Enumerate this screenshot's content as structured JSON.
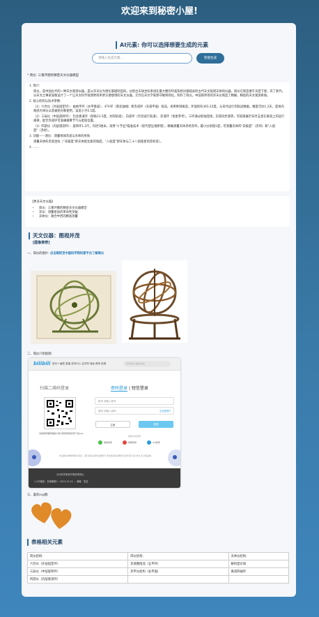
{
  "site_title": "欢迎来到秘密小屋!",
  "ai": {
    "heading": "AI元素: 你可以选择想要生成的元素",
    "placeholder": "请输入生成元素...",
    "button": "智能生成"
  },
  "summary_label": "* 简仪: 三重环圈的精密天文仪器模型",
  "article": {
    "p1": "1. 简介:",
    "p2": "简仪，是中国古代的一种天文观测仪器，是以浑天仪为理论基础制造的。分把古天球坐标系组在最大圈的环面及相对基础会的古代天文观测天体的仪器。简仪在制造便于天度下使，有了新代，分天文之事家张衡设计了一个让天文科学观测更简单更方便使用的天文仪器。元代在天文学家郭守敬将简化，制作了简仪。中国简单等的浑天仪制造了精确，精密的天文观测系统。",
    "p3": "2. 核心结构与技术参数:",
    "p4": "（1）六合仪（外层固定环）：由地平环（水平基座）、子午环（南北轴线）和赤道环（天道平面）组成。采用青铜铸造，环面刻有365.25度，与日月运行的轨迹数据，精度可达1.2天，是地内两部大体仪以及被组对象使用，误差小于0.1度。",
    "p5": "（2）三辰仪（中层旋转环）：包含黄道环（倾角23.5度，太阳轨道）、白道环（月亮运行轨道）、赤道环（恒星参考）。三环通过枢轴连接，实现同步旋转，可直观展示日月五星在黄道上的运行规律，配合赤道环可准确推算节气与星宿位置。",
    "p6": "（3）四游仪（内层观测环）：旋转环1.2尺，内径5厘米，采用\"十字丝\"瞄准技术（现代望远镜原理），精确测量天体赤经赤纬，最小分划值1度，可测量天体的\"去极度\"（赤纬）和\"入宿度\"（赤经）。",
    "p7": "3. 功能——测仪：测量地球赤道与天体的夹角",
    "p8": "测量天体的赤道坐标（\"去极度\"即天体距北极的角度，\"入宿度\"即天体与二十八宿距星的赤经差）。",
    "p9": "4. ……"
  },
  "refs": {
    "title": "【更多天文仪器】",
    "items": [
      "简仪：三重环圈的精密天文仪器模型",
      "浑仪：测量星辰的革命性突破",
      "天体仪：融合中西的精准测量"
    ]
  },
  "astro": {
    "heading": "天文仪器：图视并茂",
    "sub": "[图像推荐]",
    "l1_prefix": "一、简仪的图片:",
    "l1_link": "点击跳转至中国科学院科普平台了解简仪",
    "l2": "二、简仪介绍视频:",
    "l3": "三、喜欢svg图:"
  },
  "browser": {
    "logo": "bilibili",
    "nav": "首页 ▾  番剧  直播  游戏中心  会员购  漫画  赛事  投稿",
    "search": "搜索你感兴趣的视频",
    "tab_scan": "扫描二维码登录",
    "tab_pwd": "密码登录",
    "tab_sms": "短信登录",
    "qr_text": "请使用哔哩哔哩客户端 扫码登录或扫码下载App",
    "field_account": "账号  请输入账号",
    "field_pwd": "密码  请输入密码",
    "forgot": "忘记密码?",
    "btn_register": "注册",
    "btn_login": "登录",
    "other_login": "其他方式登录",
    "icon_wechat": "微信登录",
    "icon_weibo": "微博登录",
    "icon_qq": "QQ登录",
    "agreement": "未注册过哔哩哔哩的手机号，我们将自动帮你注册账号 登录或完成注册即代表你同意 用户协议 和 隐私政策",
    "overlay_text": "元代科学家郭守敬发明简仪",
    "overlay_bottom": "1,4万播放 · 总弹幕数0 · 2023-10-22 ...     弹幕 · 发送",
    "colors": {
      "accent": "#2a9ad8",
      "login": "#6cc8f0"
    }
  },
  "table": {
    "heading": "表格相关元素",
    "rows": [
      [
        "简仪结构:",
        "简仪结构:",
        "天体仪结构:"
      ],
      [
        "六合仪（外层固定环）",
        "赤道圈组成（五平环）",
        "解析度论球"
      ],
      [
        "三辰仪（中层旋转环）",
        "赤平仪结构（右平面）",
        "黄道四轴环"
      ],
      [
        "四游仪（内层观测环）",
        "",
        ""
      ]
    ]
  },
  "colors": {
    "heading": "#2a4a6a",
    "accent": "#2a6aa0",
    "link": "#2a7ab8",
    "hearts": "#e08a2a"
  }
}
